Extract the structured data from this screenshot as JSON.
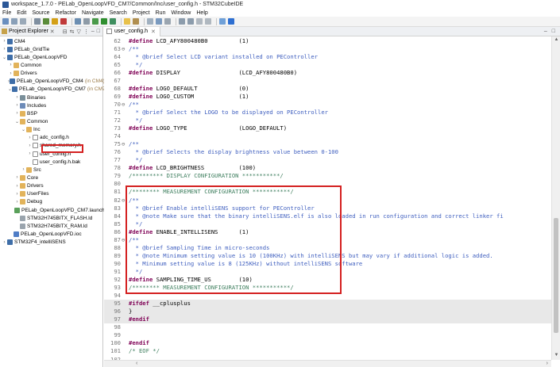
{
  "window": {
    "title": "workspace_1.7.0 - PELab_OpenLoopVFD_CM7/Common/Inc/user_config.h - STM32CubeIDE"
  },
  "menu": [
    "File",
    "Edit",
    "Source",
    "Refactor",
    "Navigate",
    "Search",
    "Project",
    "Run",
    "Window",
    "Help"
  ],
  "explorer": {
    "title": "Project Explorer",
    "items": [
      {
        "label": "CM4",
        "icon": "project-icon",
        "depth": 0,
        "arrow": "›"
      },
      {
        "label": "PELab_GridTie",
        "icon": "project-icon",
        "depth": 0,
        "arrow": "›"
      },
      {
        "label": "PELab_OpenLoopVFD",
        "icon": "project-icon",
        "depth": 0,
        "arrow": "⌄"
      },
      {
        "label": "Common",
        "icon": "folder-icon",
        "depth": 1,
        "arrow": "›"
      },
      {
        "label": "Drivers",
        "icon": "folder-icon",
        "depth": 1,
        "arrow": "›"
      },
      {
        "label": "PELab_OpenLoopVFD_CM4",
        "annotation": "(in CM4)",
        "icon": "project-icon",
        "depth": 1,
        "arrow": "›"
      },
      {
        "label": "PELab_OpenLoopVFD_CM7",
        "annotation": "(in CM7)",
        "icon": "project-icon",
        "depth": 1,
        "arrow": "⌄"
      },
      {
        "label": "Binaries",
        "icon": "binaries-icon",
        "depth": 2,
        "arrow": "›"
      },
      {
        "label": "Includes",
        "icon": "includes-icon",
        "depth": 2,
        "arrow": "›"
      },
      {
        "label": "BSP",
        "icon": "folder-icon",
        "depth": 2,
        "arrow": "›"
      },
      {
        "label": "Common",
        "icon": "folder-icon",
        "depth": 2,
        "arrow": "⌄"
      },
      {
        "label": "Inc",
        "icon": "folder-icon",
        "depth": 3,
        "arrow": "⌄"
      },
      {
        "label": "adc_config.h",
        "icon": "header-file-icon",
        "depth": 4,
        "arrow": "›"
      },
      {
        "label": "shared_memory.h",
        "icon": "header-file-icon",
        "depth": 4,
        "arrow": "›"
      },
      {
        "label": "user_config.h",
        "icon": "header-file-icon",
        "depth": 4,
        "arrow": "›"
      },
      {
        "label": "user_config.h.bak",
        "icon": "file-icon",
        "depth": 4,
        "arrow": ""
      },
      {
        "label": "Src",
        "icon": "folder-icon",
        "depth": 3,
        "arrow": "›"
      },
      {
        "label": "Core",
        "icon": "folder-icon",
        "depth": 2,
        "arrow": "›"
      },
      {
        "label": "Drivers",
        "icon": "folder-icon",
        "depth": 2,
        "arrow": "›"
      },
      {
        "label": "UserFiles",
        "icon": "folder-icon",
        "depth": 2,
        "arrow": "›"
      },
      {
        "label": "Debug",
        "icon": "folder-icon",
        "depth": 2,
        "arrow": "›"
      },
      {
        "label": "PELab_OpenLoopVFD_CM7.launch",
        "icon": "launch-file-icon",
        "depth": 2,
        "arrow": ""
      },
      {
        "label": "STM32H745BITX_FLASH.ld",
        "icon": "linker-file-icon",
        "depth": 2,
        "arrow": ""
      },
      {
        "label": "STM32H745BITX_RAM.ld",
        "icon": "linker-file-icon",
        "depth": 2,
        "arrow": ""
      },
      {
        "label": "PELab_OpenLoopVFD.ioc",
        "icon": "ioc-file-icon",
        "depth": 1,
        "arrow": ""
      },
      {
        "label": "STM32F4_intelliSENS",
        "icon": "project-icon",
        "depth": 0,
        "arrow": "›"
      }
    ]
  },
  "editor": {
    "tab": {
      "label": "user_config.h",
      "close": "✕"
    },
    "lines": [
      {
        "n": "62",
        "fold": "",
        "parts": [
          [
            "kw",
            "#define"
          ],
          [
            "plain",
            " LCD_AFY800480B0         (1)"
          ]
        ]
      },
      {
        "n": "63",
        "fold": "⊖",
        "parts": [
          [
            "cm",
            "/**"
          ]
        ]
      },
      {
        "n": "64",
        "fold": "",
        "parts": [
          [
            "cm",
            "  * @brief Select LCD variant installed on PEController"
          ]
        ]
      },
      {
        "n": "65",
        "fold": "",
        "parts": [
          [
            "cm",
            "  */"
          ]
        ]
      },
      {
        "n": "66",
        "fold": "",
        "parts": [
          [
            "kw",
            "#define"
          ],
          [
            "plain",
            " DISPLAY                 (LCD_AFY800480B0)"
          ]
        ]
      },
      {
        "n": "67",
        "fold": "",
        "parts": []
      },
      {
        "n": "68",
        "fold": "",
        "parts": [
          [
            "kw",
            "#define"
          ],
          [
            "plain",
            " LOGO_DEFAULT            (0)"
          ]
        ]
      },
      {
        "n": "69",
        "fold": "",
        "parts": [
          [
            "kw",
            "#define"
          ],
          [
            "plain",
            " LOGO_CUSTOM             (1)"
          ]
        ]
      },
      {
        "n": "70",
        "fold": "⊖",
        "parts": [
          [
            "cm",
            "/**"
          ]
        ]
      },
      {
        "n": "71",
        "fold": "",
        "parts": [
          [
            "cm",
            "  * @brief Select the LOGO to be displayed on PEController"
          ]
        ]
      },
      {
        "n": "72",
        "fold": "",
        "parts": [
          [
            "cm",
            "  */"
          ]
        ]
      },
      {
        "n": "73",
        "fold": "",
        "parts": [
          [
            "kw",
            "#define"
          ],
          [
            "plain",
            " LOGO_TYPE               (LOGO_DEFAULT)"
          ]
        ]
      },
      {
        "n": "74",
        "fold": "",
        "parts": []
      },
      {
        "n": "75",
        "fold": "⊖",
        "parts": [
          [
            "cm",
            "/**"
          ]
        ]
      },
      {
        "n": "76",
        "fold": "",
        "parts": [
          [
            "cm",
            "  * @brief Selects the display brightness value between 0-100"
          ]
        ]
      },
      {
        "n": "77",
        "fold": "",
        "parts": [
          [
            "cm",
            "  */"
          ]
        ]
      },
      {
        "n": "78",
        "fold": "",
        "parts": [
          [
            "kw",
            "#define"
          ],
          [
            "plain",
            " LCD_BRIGHTNESS          (100)"
          ]
        ]
      },
      {
        "n": "79",
        "fold": "",
        "parts": [
          [
            "cm2",
            "/********* DISPLAY CONFIGURATION ***********/"
          ]
        ]
      },
      {
        "n": "80",
        "fold": "",
        "parts": []
      },
      {
        "n": "81",
        "fold": "",
        "parts": [
          [
            "cm2",
            "/******** MEASUREMENT CONFIGURATION ***********/"
          ]
        ]
      },
      {
        "n": "82",
        "fold": "⊖",
        "parts": [
          [
            "cm",
            "/**"
          ]
        ]
      },
      {
        "n": "83",
        "fold": "",
        "parts": [
          [
            "cm",
            "  * @brief Enable intelliSENS support for PEController"
          ]
        ]
      },
      {
        "n": "84",
        "fold": "",
        "parts": [
          [
            "cm",
            "  * @note Make sure that the binary intelliSENS.elf is also loaded in run configuration and correct linker fi"
          ]
        ]
      },
      {
        "n": "85",
        "fold": "",
        "parts": [
          [
            "cm",
            "  */"
          ]
        ]
      },
      {
        "n": "86",
        "fold": "",
        "parts": [
          [
            "kw",
            "#define"
          ],
          [
            "plain",
            " ENABLE_INTELLISENS      (1)"
          ]
        ]
      },
      {
        "n": "87",
        "fold": "⊖",
        "parts": [
          [
            "cm",
            "/**"
          ]
        ]
      },
      {
        "n": "88",
        "fold": "",
        "parts": [
          [
            "cm",
            "  * @brief Sampling Time in micro-seconds"
          ]
        ]
      },
      {
        "n": "89",
        "fold": "",
        "parts": [
          [
            "cm",
            "  * @note Minimum setting value is 10 (100KHz) with intelliSENS but may vary if additional logic is added."
          ]
        ]
      },
      {
        "n": "90",
        "fold": "",
        "parts": [
          [
            "cm",
            "  * Minimum setting value is 8 (125KHz) without intelliSENS software"
          ]
        ]
      },
      {
        "n": "91",
        "fold": "",
        "parts": [
          [
            "cm",
            "  */"
          ]
        ]
      },
      {
        "n": "92",
        "fold": "",
        "parts": [
          [
            "kw",
            "#define"
          ],
          [
            "plain",
            " SAMPLING_TIME_US        (10)"
          ]
        ]
      },
      {
        "n": "93",
        "fold": "",
        "parts": [
          [
            "cm2",
            "/******** MEASUREMENT CONFIGURATION ***********/"
          ]
        ]
      },
      {
        "n": "94",
        "fold": "",
        "parts": []
      },
      {
        "n": "95",
        "fold": "",
        "hl": true,
        "parts": [
          [
            "kw",
            "#ifdef"
          ],
          [
            "plain",
            " __cplusplus"
          ]
        ]
      },
      {
        "n": "96",
        "fold": "",
        "hl": true,
        "parts": [
          [
            "plain",
            "}"
          ]
        ]
      },
      {
        "n": "97",
        "fold": "",
        "hl": true,
        "parts": [
          [
            "kw",
            "#endif"
          ]
        ]
      },
      {
        "n": "98",
        "fold": "",
        "parts": []
      },
      {
        "n": "99",
        "fold": "",
        "parts": []
      },
      {
        "n": "100",
        "fold": "",
        "parts": [
          [
            "kw",
            "#endif"
          ]
        ]
      },
      {
        "n": "101",
        "fold": "",
        "parts": [
          [
            "cm2",
            "/* EOF */"
          ]
        ]
      },
      {
        "n": "102",
        "fold": "",
        "parts": []
      }
    ]
  }
}
